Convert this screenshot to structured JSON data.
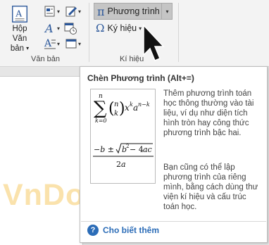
{
  "ribbon": {
    "text_group": {
      "textbox_label_line1": "Hộp Văn",
      "textbox_label_line2": "bản",
      "group_label": "Văn bản"
    },
    "symbols_group": {
      "equation_label": "Phương trình",
      "symbol_label": "Ký hiệu",
      "group_label": "Kí hiệu"
    }
  },
  "tooltip": {
    "title": "Chèn Phương trình (Alt+=)",
    "para1": "Thêm phương trình toán học thông thường vào tài liệu, ví dụ như diện tích hình tròn hay công thức phương trình bậc hai.",
    "para2": "Bạn cũng có thể lập phương trình của riêng mình, bằng cách dùng thư viện kí hiệu và cấu trúc toán học.",
    "help_label": "Cho biết thêm"
  },
  "watermark": "VnDoc.com",
  "colors": {
    "accent": "#2b579a",
    "link": "#2b6cb7",
    "watermark": "#f5c04a"
  }
}
